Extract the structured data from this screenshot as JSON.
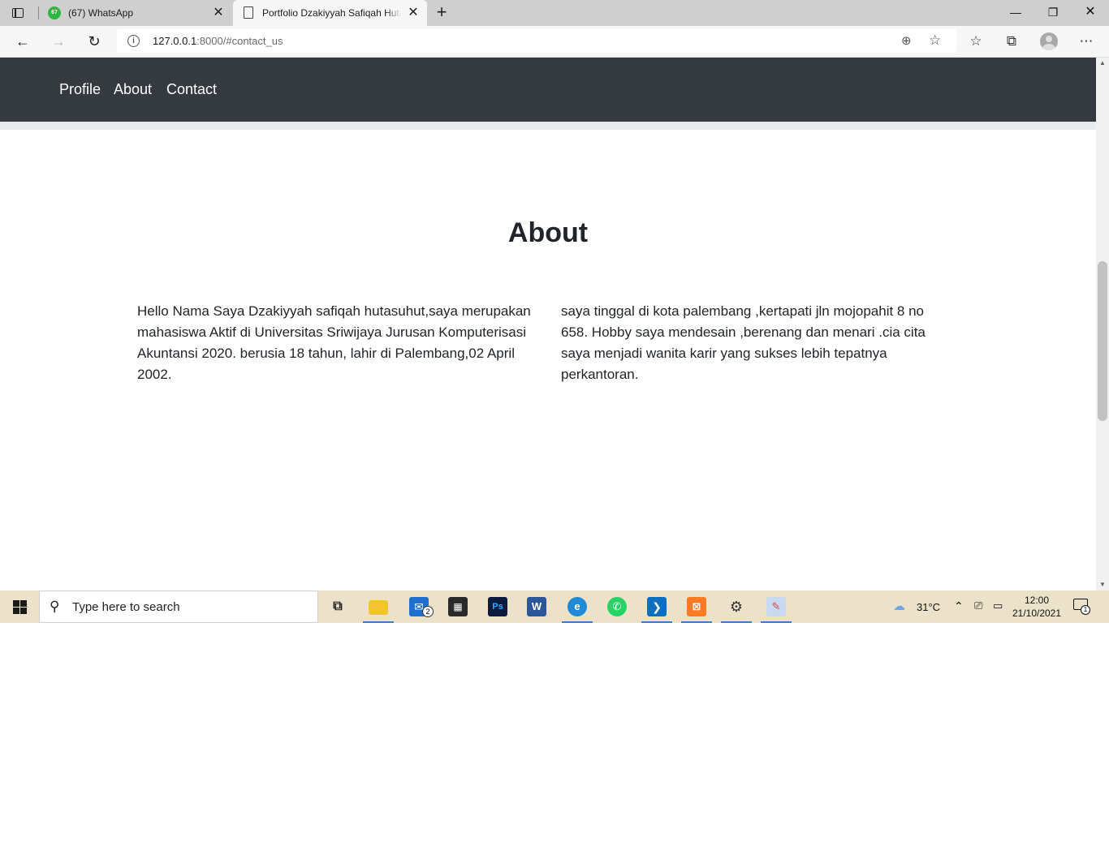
{
  "browser": {
    "tabs": [
      {
        "title": "(67) WhatsApp",
        "favicon_badge": "67"
      },
      {
        "title": "Portfolio Dzakiyyah Safiqah Hutasuhut"
      }
    ],
    "url_host": "127.0.0.1",
    "url_rest": ":8000/#contact_us"
  },
  "navbar": {
    "links": [
      "Profile",
      "About",
      "Contact"
    ],
    "background": "#343a40"
  },
  "about": {
    "title": "About",
    "left_text": "Hello Nama Saya Dzakiyyah safiqah hutasuhut,saya merupakan mahasiswa Aktif di Universitas Sriwijaya Jurusan Komputerisasi Akuntansi 2020. berusia 18 tahun, lahir di Palembang,02 April 2002.",
    "right_text": "saya tinggal di kota palembang ,kertapati jln mojopahit 8 no 658. Hobby saya mendesain ,berenang dan menari .cia cita saya menjadi wanita karir yang sukses lebih tepatnya perkantoran."
  },
  "taskbar": {
    "search_placeholder": "Type here to search",
    "mail_badge": "2",
    "temperature": "31°C",
    "time": "12:00",
    "date": "21/10/2021",
    "notification_count": "1"
  }
}
